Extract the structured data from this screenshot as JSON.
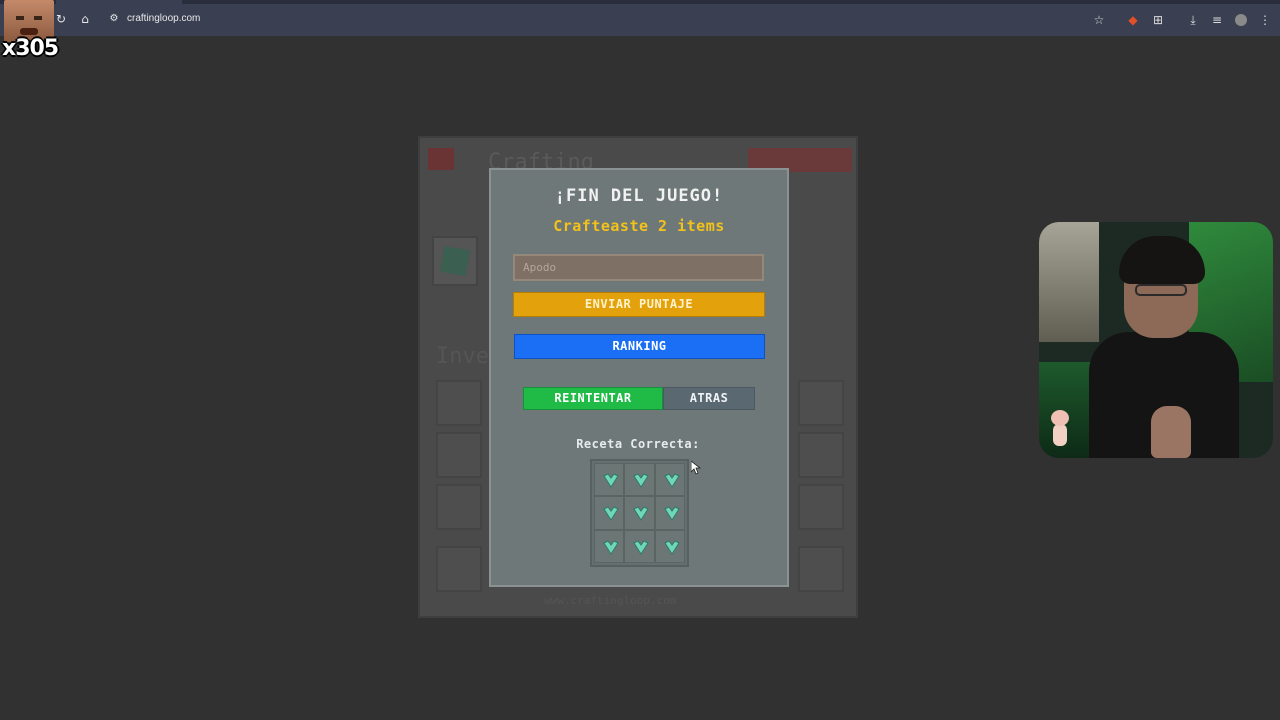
{
  "browser": {
    "url": "craftingloop.com"
  },
  "overlay": {
    "counter": "x305"
  },
  "modal": {
    "title": "¡FIN DEL JUEGO!",
    "subtitle": "Crafteaste 2 items",
    "nickname_placeholder": "Apodo",
    "nickname_value": "",
    "send_label": "ENVIAR PUNTAJE",
    "ranking_label": "RANKING",
    "retry_label": "REINTENTAR",
    "back_label": "ATRAS",
    "recipe_label": "Receta Correcta:",
    "recipe_grid": [
      "diamond",
      "diamond",
      "diamond",
      "diamond",
      "diamond",
      "diamond",
      "diamond",
      "diamond",
      "diamond"
    ]
  },
  "background_page": {
    "title": "Crafting",
    "inventory_label": "Inve",
    "footer": "www.craftingloop.com"
  },
  "colors": {
    "send_button": "#e3a20c",
    "ranking_button": "#1a6ff5",
    "retry_button": "#1fbb46",
    "back_button": "#5a6872",
    "subtitle": "#f3c21a",
    "gem": "#6fd6b8"
  }
}
